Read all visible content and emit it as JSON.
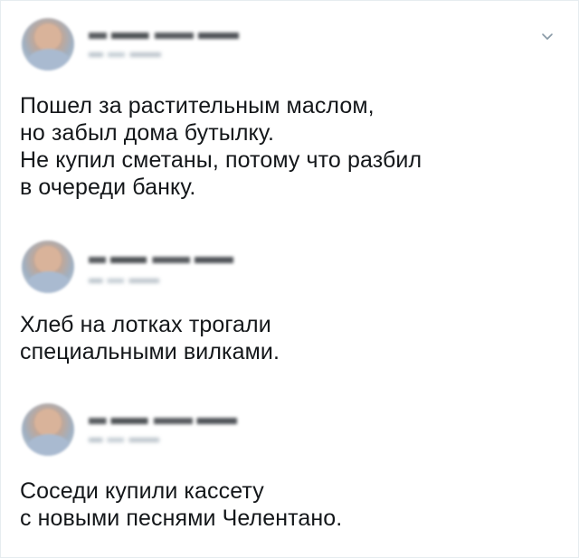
{
  "tweets": [
    {
      "lines": [
        "Пошел за растительным маслом,",
        "но забыл дома бутылку.",
        "Не купил сметаны, потому что разбил",
        "в очереди банку."
      ]
    },
    {
      "lines": [
        "Хлеб на лотках трогали",
        "специальными вилками."
      ]
    },
    {
      "lines": [
        "Соседи купили кассету",
        "с новыми песнями Челентано."
      ]
    }
  ],
  "icons": {
    "menu": "chevron-down-icon",
    "avatar": "avatar"
  },
  "colors": {
    "text": "#14171a",
    "chevron": "#8899a6",
    "border": "#e6ecf0"
  }
}
